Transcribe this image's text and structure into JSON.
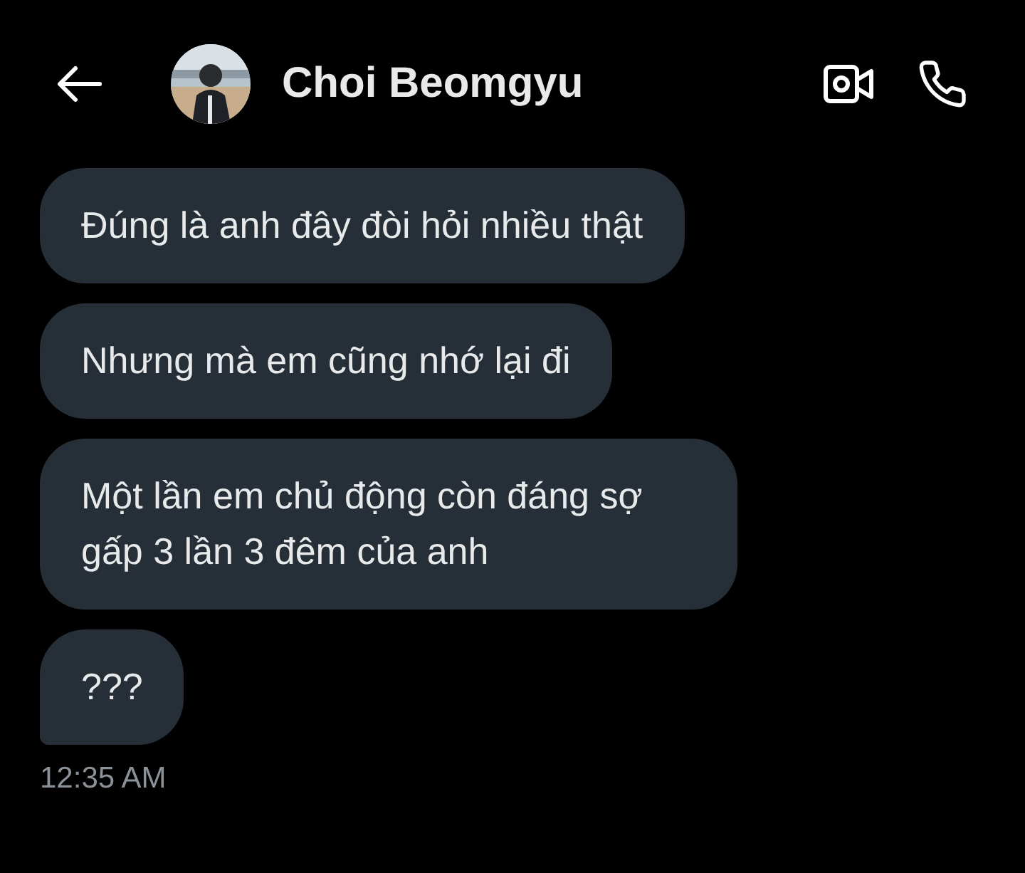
{
  "header": {
    "contact_name": "Choi Beomgyu"
  },
  "messages": [
    {
      "text": "Đúng là anh đây đòi hỏi nhiều thật"
    },
    {
      "text": "Nhưng mà em cũng nhớ lại đi"
    },
    {
      "text": "Một lần em chủ động còn đáng sợ gấp 3 lần 3 đêm của anh"
    },
    {
      "text": "???"
    }
  ],
  "timestamp": "12:35 AM"
}
